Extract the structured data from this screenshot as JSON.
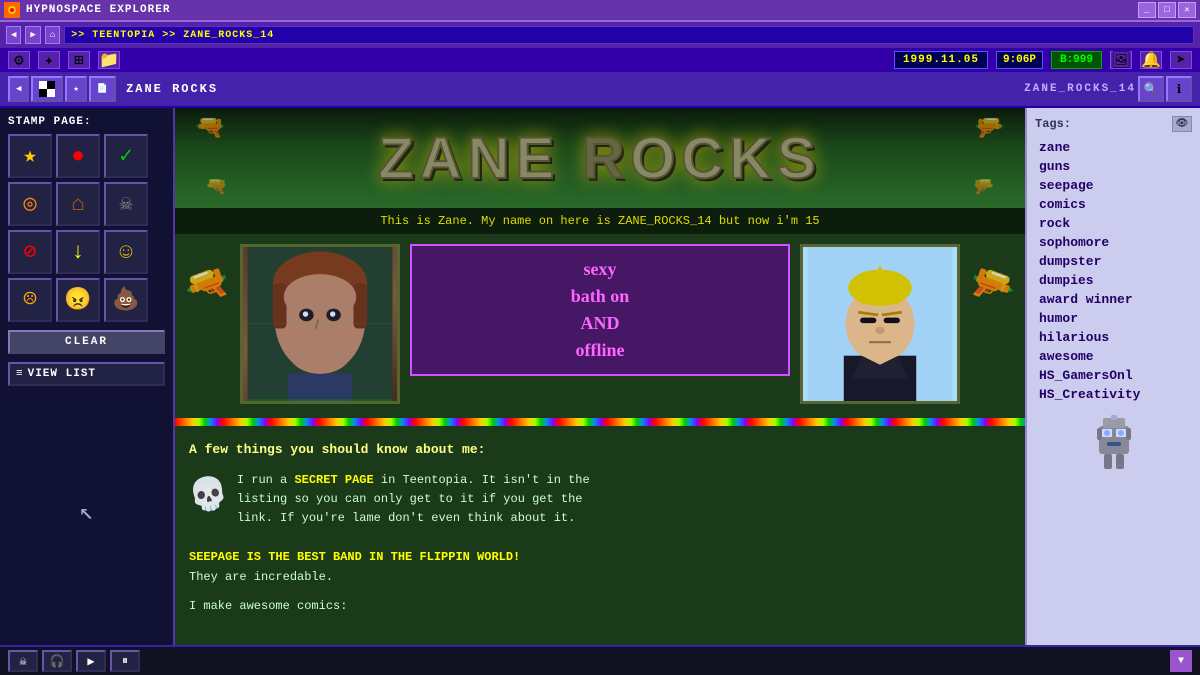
{
  "window": {
    "title": "HYPNOSPACE EXPLORER",
    "address": ">> TEENTOPIA >> ZANE_ROCKS_14"
  },
  "infobar": {
    "date": "1999.11.05",
    "time": "9:06P",
    "credits": "B:999"
  },
  "toolbar": {
    "page_name": "ZANE ROCKS",
    "page_id": "ZANE_ROCKS_14",
    "back_label": "◀",
    "nav_icon": "⌂"
  },
  "stamps": {
    "label": "STAMP PAGE:",
    "items": [
      {
        "symbol": "★",
        "color": "#ffcc00"
      },
      {
        "symbol": "●",
        "color": "#ff0000"
      },
      {
        "symbol": "✓",
        "color": "#00aa00"
      },
      {
        "symbol": "◎",
        "color": "#ff8800"
      },
      {
        "symbol": "⌂",
        "color": "#aa6600"
      },
      {
        "symbol": "☠",
        "color": "#888888"
      },
      {
        "symbol": "⊘",
        "color": "#ff0000"
      },
      {
        "symbol": "↓",
        "color": "#ffff00"
      },
      {
        "symbol": "☺",
        "color": "#ffcc00"
      },
      {
        "symbol": "☹",
        "color": "#ffaa00"
      },
      {
        "symbol": "☻",
        "color": "#ffaa00"
      },
      {
        "symbol": "💩",
        "color": "#aa6600"
      }
    ],
    "clear_label": "CLEAR",
    "view_list_label": "VIEW LIST"
  },
  "page": {
    "banner_title": "ZANE ROCKS",
    "intro_text": "This is Zane. My name on here is ZANE_ROCKS_14 but now i'm 15",
    "sexy_text": "sexy\nbath on\nAND\noffline",
    "bio_heading": "A few things you should know about me:",
    "bio_paragraphs": [
      "I run a SECRET PAGE in Teentopia. It isn't in the listing so you can only get to it if you get the link. If you're lame don't even think about it.",
      "SEEPAGE IS THE BEST BAND IN THE FLIPPIN WORLD! They are incredable.",
      "I make awesome comics:"
    ]
  },
  "tags": {
    "header": "Tags:",
    "items": [
      "zane",
      "guns",
      "seepage",
      "comics",
      "rock",
      "sophomore",
      "dumpster",
      "dumpies",
      "award winner",
      "humor",
      "hilarious",
      "awesome",
      "HS_GamersOnl",
      "HS_Creativity"
    ]
  },
  "bottom": {
    "skull_icon": "☠",
    "headphone_icon": "🎧",
    "play_icon": "▶",
    "pause_icon": "⏸"
  }
}
